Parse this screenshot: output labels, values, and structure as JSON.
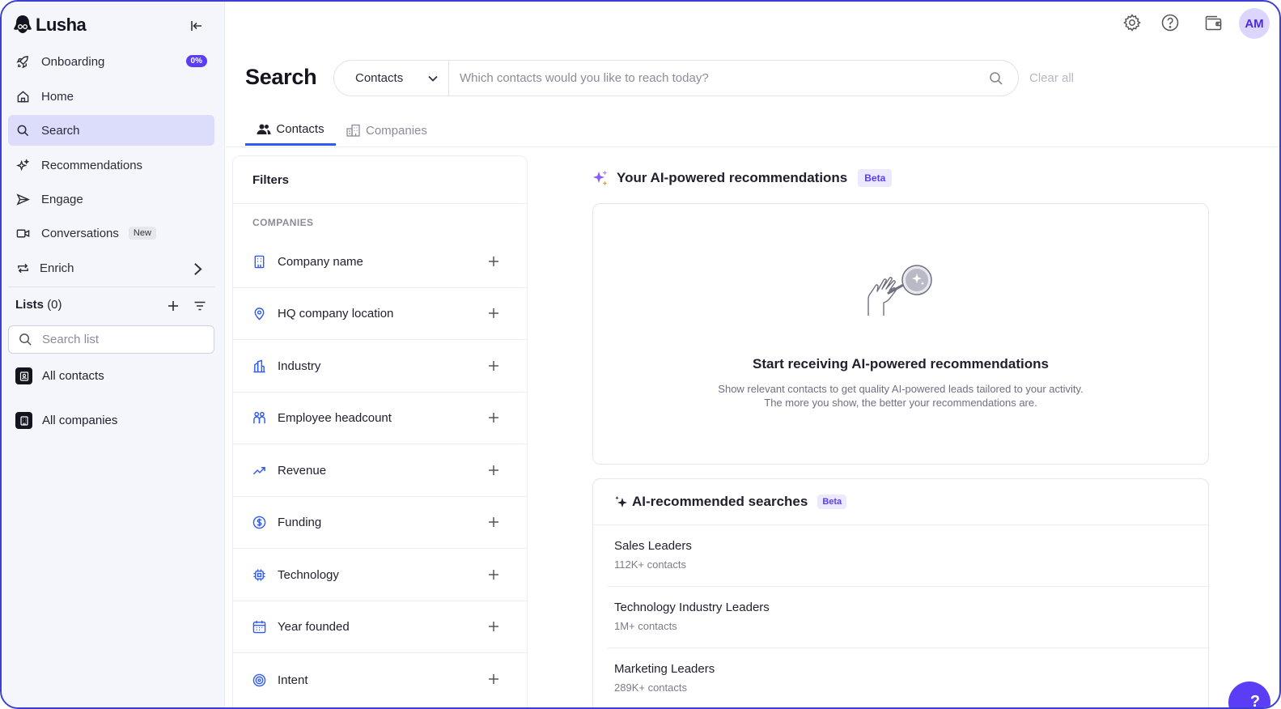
{
  "app": {
    "logo_text": "Lusha"
  },
  "sidebar": {
    "nav": [
      {
        "label": "Onboarding",
        "icon": "rocket-icon",
        "badge": "0%"
      },
      {
        "label": "Home",
        "icon": "home-icon"
      },
      {
        "label": "Search",
        "icon": "search-icon",
        "active": true
      },
      {
        "label": "Recommendations",
        "icon": "sparkles-icon"
      },
      {
        "label": "Engage",
        "icon": "send-icon"
      },
      {
        "label": "Conversations",
        "icon": "video-icon",
        "badge": "New"
      },
      {
        "label": "Enrich",
        "icon": "refresh-arrows-icon"
      }
    ],
    "lists": {
      "title": "Lists",
      "count": "(0)",
      "search_placeholder": "Search list",
      "items": [
        {
          "label": "All contacts",
          "icon": "contact-card-icon"
        },
        {
          "label": "All companies",
          "icon": "building-icon"
        }
      ]
    }
  },
  "header": {
    "avatar_initials": "AM",
    "icons": [
      "gear-icon",
      "help-icon",
      "wallet-icon"
    ]
  },
  "search": {
    "title": "Search",
    "scope": "Contacts",
    "placeholder": "Which contacts would you like to reach today?",
    "clear_all": "Clear all",
    "tabs": [
      {
        "label": "Contacts",
        "active": true
      },
      {
        "label": "Companies",
        "active": false
      }
    ]
  },
  "filters": {
    "title": "Filters",
    "section": "COMPANIES",
    "items": [
      {
        "label": "Company name",
        "icon": "building-icon"
      },
      {
        "label": "HQ company location",
        "icon": "location-pin-icon"
      },
      {
        "label": "Industry",
        "icon": "industry-icon"
      },
      {
        "label": "Employee headcount",
        "icon": "people-icon"
      },
      {
        "label": "Revenue",
        "icon": "trend-up-icon"
      },
      {
        "label": "Funding",
        "icon": "dollar-circle-icon"
      },
      {
        "label": "Technology",
        "icon": "chip-icon"
      },
      {
        "label": "Year founded",
        "icon": "calendar-icon"
      },
      {
        "label": "Intent",
        "icon": "target-icon"
      }
    ]
  },
  "ai_recommendations": {
    "title": "Your AI-powered recommendations",
    "badge": "Beta",
    "empty_title": "Start receiving AI-powered recommendations",
    "empty_desc_line1": "Show relevant contacts to get quality AI-powered leads tailored to your activity.",
    "empty_desc_line2": "The more you show, the better your recommendations are."
  },
  "recommended_searches": {
    "title": "AI-recommended searches",
    "badge": "Beta",
    "items": [
      {
        "name": "Sales Leaders",
        "count": "112K+ contacts"
      },
      {
        "name": "Technology Industry Leaders",
        "count": "1M+ contacts"
      },
      {
        "name": "Marketing Leaders",
        "count": "289K+ contacts"
      }
    ]
  },
  "help": {
    "label": "?"
  },
  "colors": {
    "accent": "#5b3df5",
    "link_blue": "#2f5bf0",
    "sidebar_bg": "#f5f6fb",
    "active_nav_bg": "#dcdcfb"
  }
}
